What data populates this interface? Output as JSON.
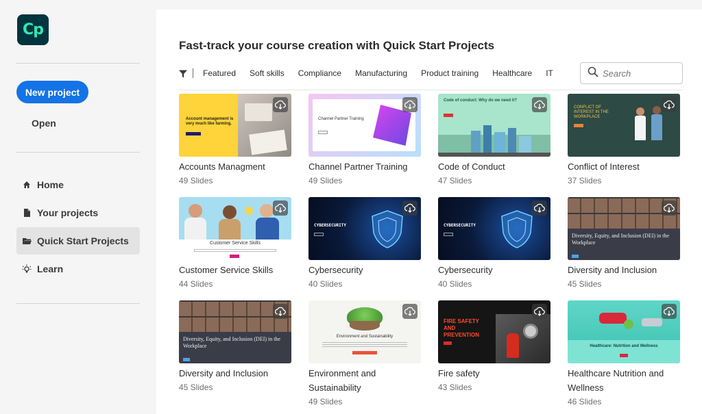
{
  "app": {
    "logo_text": "Cp"
  },
  "sidebar": {
    "new_project_label": "New project",
    "open_label": "Open",
    "nav": [
      {
        "label": "Home",
        "icon": "home-icon"
      },
      {
        "label": "Your projects",
        "icon": "document-icon"
      },
      {
        "label": "Quick Start Projects",
        "icon": "folder-icon",
        "active": true
      },
      {
        "label": "Learn",
        "icon": "lightbulb-icon"
      }
    ]
  },
  "main": {
    "title": "Fast-track your course creation with Quick Start Projects",
    "filters": [
      "Featured",
      "Soft skills",
      "Compliance",
      "Manufacturing",
      "Product training",
      "Healthcare",
      "IT"
    ],
    "search_placeholder": "Search",
    "cards": [
      {
        "title": "Accounts Managment",
        "slides": "49 Slides",
        "thumb_text": "Account management is very much like farming."
      },
      {
        "title": "Channel Partner Training",
        "slides": "49 Slides",
        "thumb_text": "Channel Partner Training"
      },
      {
        "title": "Code of Conduct",
        "slides": "47 Slides",
        "thumb_text": "Code of conduct: Why do we need it?"
      },
      {
        "title": "Conflict of Interest",
        "slides": "37 Slides",
        "thumb_text": "CONFLICT OF INTEREST IN THE WORKPLACE"
      },
      {
        "title": "Customer Service Skills",
        "slides": "44 Slides",
        "thumb_text": "Customer Service Skills"
      },
      {
        "title": "Cybersecurity",
        "slides": "40 Slides",
        "thumb_text": "CYBERSECURITY"
      },
      {
        "title": "Cybersecurity",
        "slides": "40 Slides",
        "thumb_text": "CYBERSECURITY"
      },
      {
        "title": "Diversity and Inclusion",
        "slides": "45 Slides",
        "thumb_text": "Diversity, Equity, and Inclusion (DEI) in the Workplace"
      },
      {
        "title": "Diversity and Inclusion",
        "slides": "45 Slides",
        "thumb_text": "Diversity, Equity, and Inclusion (DEI) in the Workplace"
      },
      {
        "title": "Environment and Sustainability",
        "slides": "49 Slides",
        "thumb_text": "Environment and Sustainability"
      },
      {
        "title": "Fire safety",
        "slides": "43 Slides",
        "thumb_text": "FIRE SAFETY AND PREVENTION"
      },
      {
        "title": "Healthcare Nutrition and Wellness",
        "slides": "46 Slides",
        "thumb_text": "Healthcare: Nutrition and Wellness"
      }
    ]
  },
  "colors": {
    "accent": "#1473e6",
    "logo_bg": "#00343f",
    "logo_fg": "#31e8b3"
  }
}
